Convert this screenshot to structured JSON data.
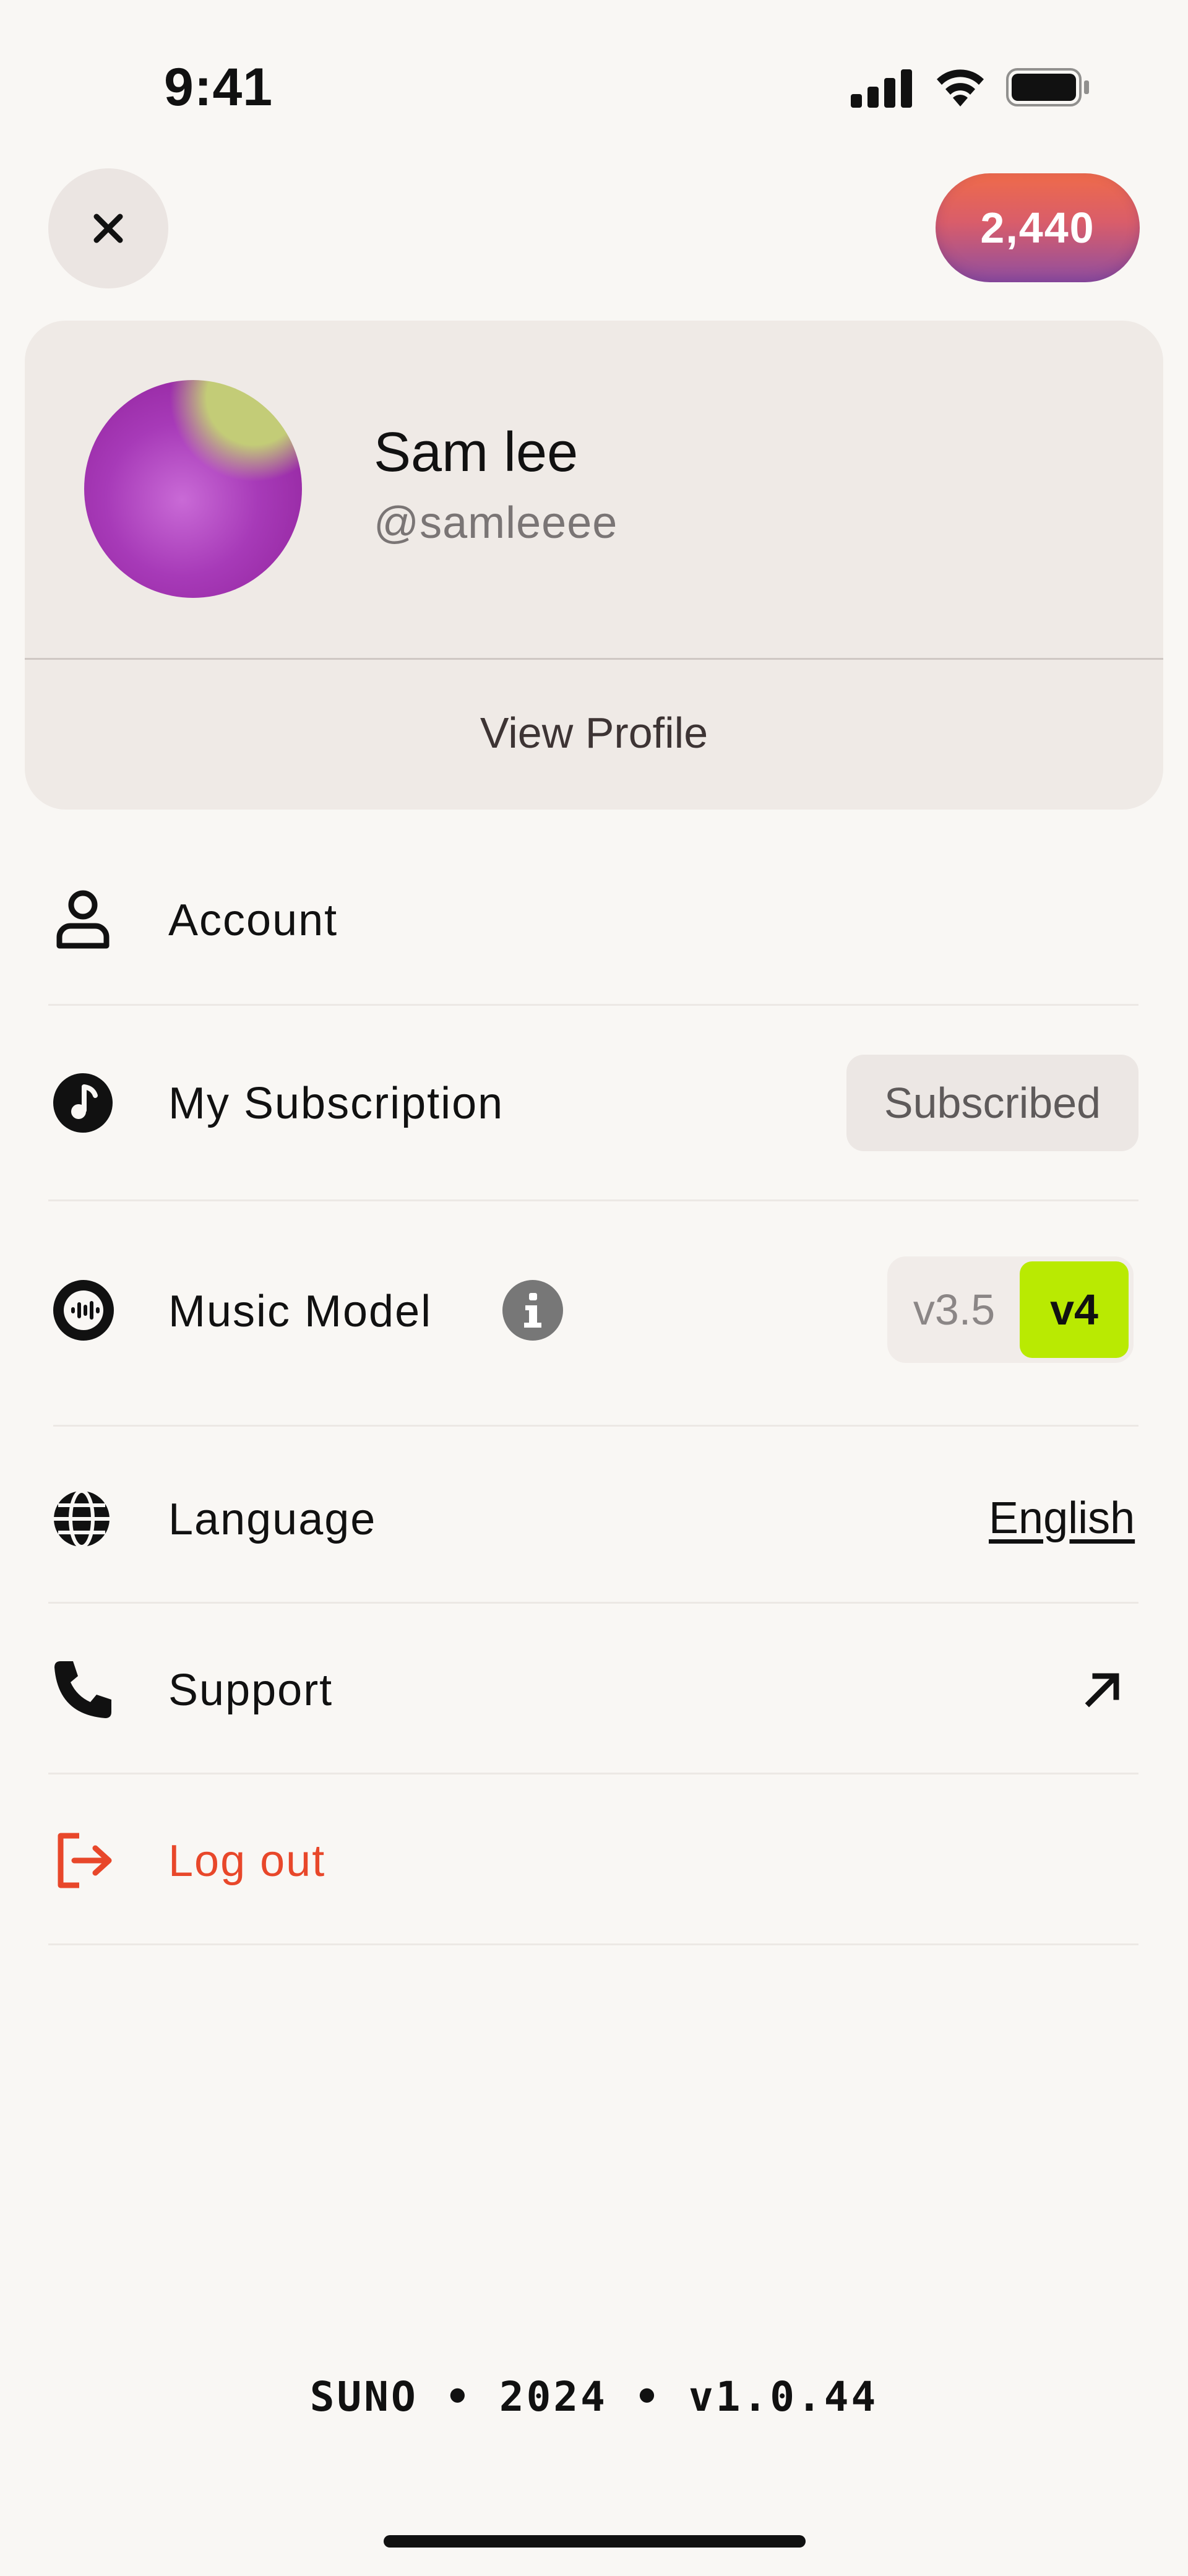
{
  "status_bar": {
    "time": "9:41"
  },
  "header": {
    "credits": "2,440"
  },
  "profile": {
    "name": "Sam lee",
    "handle": "@samleeee",
    "view_profile_label": "View Profile"
  },
  "menu": {
    "account": {
      "label": "Account",
      "icon": "person-icon"
    },
    "subscription": {
      "label": "My Subscription",
      "icon": "music-note-icon",
      "badge": "Subscribed"
    },
    "music_model": {
      "label": "Music Model",
      "icon": "waveform-icon",
      "options": [
        "v3.5",
        "v4"
      ],
      "selected": "v4"
    },
    "language": {
      "label": "Language",
      "icon": "globe-icon",
      "value": "English"
    },
    "support": {
      "label": "Support",
      "icon": "phone-icon"
    },
    "logout": {
      "label": "Log out",
      "icon": "logout-icon"
    }
  },
  "footer": {
    "text": "SUNO • 2024 • v1.0.44"
  },
  "colors": {
    "background": "#f9f7f4",
    "card": "#efeae6",
    "accent_lime": "#b9ea02",
    "logout_red": "#e8472a",
    "credits_gradient_top": "#ef6b4a",
    "credits_gradient_bottom": "#8f4ea0"
  }
}
